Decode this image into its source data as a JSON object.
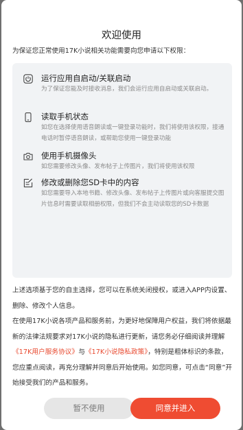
{
  "dialog": {
    "title": "欢迎使用",
    "intro": "为保证您正常使用17K小说相关功能需要向您申请以下权限：",
    "permissions": [
      {
        "icon": "power-icon",
        "title": "运行应用自启动/关联启动",
        "desc": "为了保证您能及时接收消息，我们会运行应用自启动或关联启动。"
      },
      {
        "icon": "phone-icon",
        "title": "读取手机状态",
        "desc": "如您在选择使用语音朗读或一键登录功能时，我们将使用该权限，接通电话时暂停语音朗读，或帮助您使用一键登录功能"
      },
      {
        "icon": "camera-icon",
        "title": "使用手机摄像头",
        "desc": "如您需要修改头像、发布帖子上传图片，我们将使用该权限"
      },
      {
        "icon": "edit-icon",
        "title": "修改或删除您SD卡中的内容",
        "desc": "如您需要导入本地书籍、修改头像、发布帖子上传图片或向客服提交图片信息时需要读取相册权限，但我们不会主动读取您的SD卡数据"
      }
    ],
    "settings_note": "上述选项基于您的自主选择，您可以在系统关闭授权，或进入APP内设置、删除、修改个人信息。",
    "policy_text_1": "在使用17K小说各项产品和服务前，为更好地保障用户权益，我们将依据最新的法律法规要求对17K小说的隐私进行更新，请您务必仔细阅读并理解",
    "service_agreement_link": "《17K用户服务协议》",
    "and_text": "与",
    "privacy_policy_link": "《17K小说隐私政策》",
    "policy_text_2": "，特别是粗体标识的条款，您应重点阅读，再充分理解并同意后开始使用。如您同意，可点击“同意”开始接受我们的产品和服务。",
    "decline_label": "暂不使用",
    "agree_label": "同意并进入"
  },
  "colors": {
    "accent": "#ef4c32",
    "link": "#e8492f",
    "panel_bg": "#f1f3f5"
  }
}
